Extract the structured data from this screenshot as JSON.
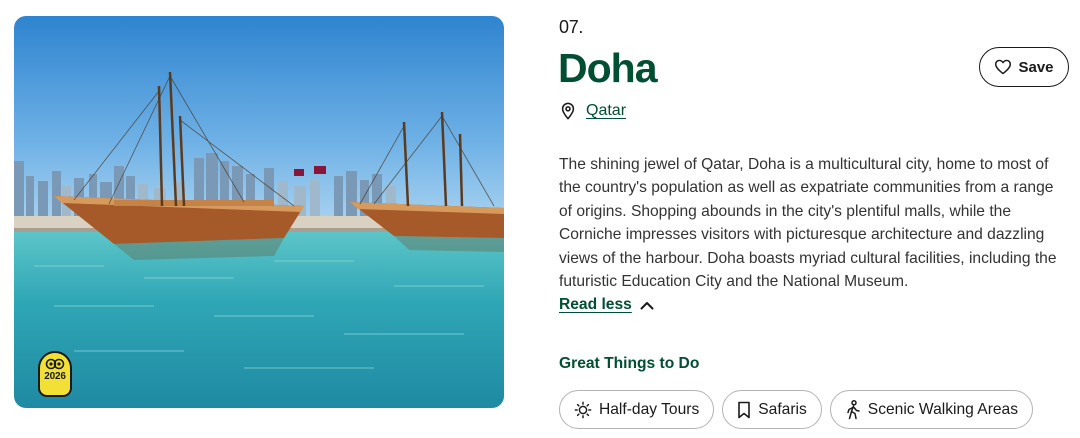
{
  "destination": {
    "rank": "07.",
    "name": "Doha",
    "location_label": "Qatar",
    "save_label": "Save",
    "description": "The shining jewel of Qatar, Doha is a multicultural city, home to most of the country's population as well as expatriate communities from a range of origins. Shopping abounds in the city's plentiful malls, while the Corniche impresses visitors with picturesque architecture and dazzling views of the harbour. Doha boasts myriad cultural facilities, including the futuristic Education City and the National Museum.",
    "read_less_label": "Read less"
  },
  "photo": {
    "award_year": "2026"
  },
  "things_to_do": {
    "heading": "Great Things to Do",
    "chips": [
      {
        "label": "Half-day Tours",
        "icon": "sun-icon"
      },
      {
        "label": "Safaris",
        "icon": "bookmark-icon"
      },
      {
        "label": "Scenic Walking Areas",
        "icon": "walking-person-icon"
      }
    ]
  },
  "colors": {
    "brand_green": "#004f32",
    "award_yellow": "#f2e037",
    "text": "#333333"
  }
}
